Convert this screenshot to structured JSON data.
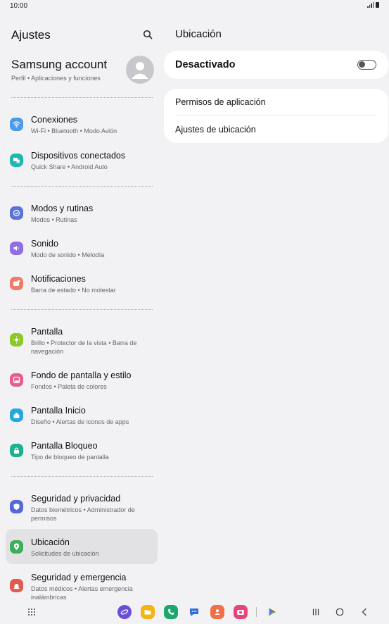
{
  "status": {
    "time": "10:00"
  },
  "left": {
    "title": "Ajustes",
    "account": {
      "name": "Samsung account",
      "sub": "Perfil  •  Aplicaciones y funciones"
    },
    "items": [
      {
        "title": "Conexiones",
        "sub": "Wi-Fi  •  Bluetooth  •  Modo Avión",
        "icon": "wifi-icon",
        "color": "#4a9be8"
      },
      {
        "title": "Dispositivos conectados",
        "sub": "Quick Share  •  Android Auto",
        "icon": "devices-icon",
        "color": "#1fb8b0"
      },
      {
        "title": "Modos y rutinas",
        "sub": "Modos  •  Rutinas",
        "icon": "modes-icon",
        "color": "#5a73d9"
      },
      {
        "title": "Sonido",
        "sub": "Modo de sonido  •  Melodía",
        "icon": "sound-icon",
        "color": "#8f6ee6"
      },
      {
        "title": "Notificaciones",
        "sub": "Barra de estado  •  No molestar",
        "icon": "notification-icon",
        "color": "#ee7c67"
      },
      {
        "title": "Pantalla",
        "sub": "Brillo  •  Protector de la vista  •  Barra de navegación",
        "icon": "display-icon",
        "color": "#8cc926"
      },
      {
        "title": "Fondo de pantalla y estilo",
        "sub": "Fondos  •  Paleta de colores",
        "icon": "wallpaper-icon",
        "color": "#e65c8a"
      },
      {
        "title": "Pantalla Inicio",
        "sub": "Diseño  •  Alertas de iconos de apps",
        "icon": "home-icon",
        "color": "#25a8e0"
      },
      {
        "title": "Pantalla Bloqueo",
        "sub": "Tipo de bloqueo de pantalla",
        "icon": "lock-icon",
        "color": "#1bb38f"
      },
      {
        "title": "Seguridad y privacidad",
        "sub": "Datos biométricos  •  Administrador de permisos",
        "icon": "shield-icon",
        "color": "#5468d8"
      },
      {
        "title": "Ubicación",
        "sub": "Solicitudes de ubicación",
        "icon": "location-icon",
        "color": "#3fae5a"
      },
      {
        "title": "Seguridad y emergencia",
        "sub": "Datos médicos  •  Alertas emergencia inalámbricas",
        "icon": "emergency-icon",
        "color": "#e05a4e"
      }
    ]
  },
  "right": {
    "title": "Ubicación",
    "toggle_label": "Desactivado",
    "toggle_on": false,
    "rows": [
      "Permisos de aplicación",
      "Ajustes de ubicación"
    ]
  },
  "dock": {
    "apps": [
      {
        "icon": "internet-app-icon",
        "color": "#6a4fd6"
      },
      {
        "icon": "files-app-icon",
        "color": "#f5b318"
      },
      {
        "icon": "phone-app-icon",
        "color": "#1aa86b"
      },
      {
        "icon": "messages-app-icon",
        "color": "#2f6de0"
      },
      {
        "icon": "contacts-app-icon",
        "color": "#f07147"
      },
      {
        "icon": "camera-app-icon",
        "color": "#e8447a"
      },
      {
        "icon": "play-store-app-icon",
        "color": "#34a853"
      }
    ]
  }
}
